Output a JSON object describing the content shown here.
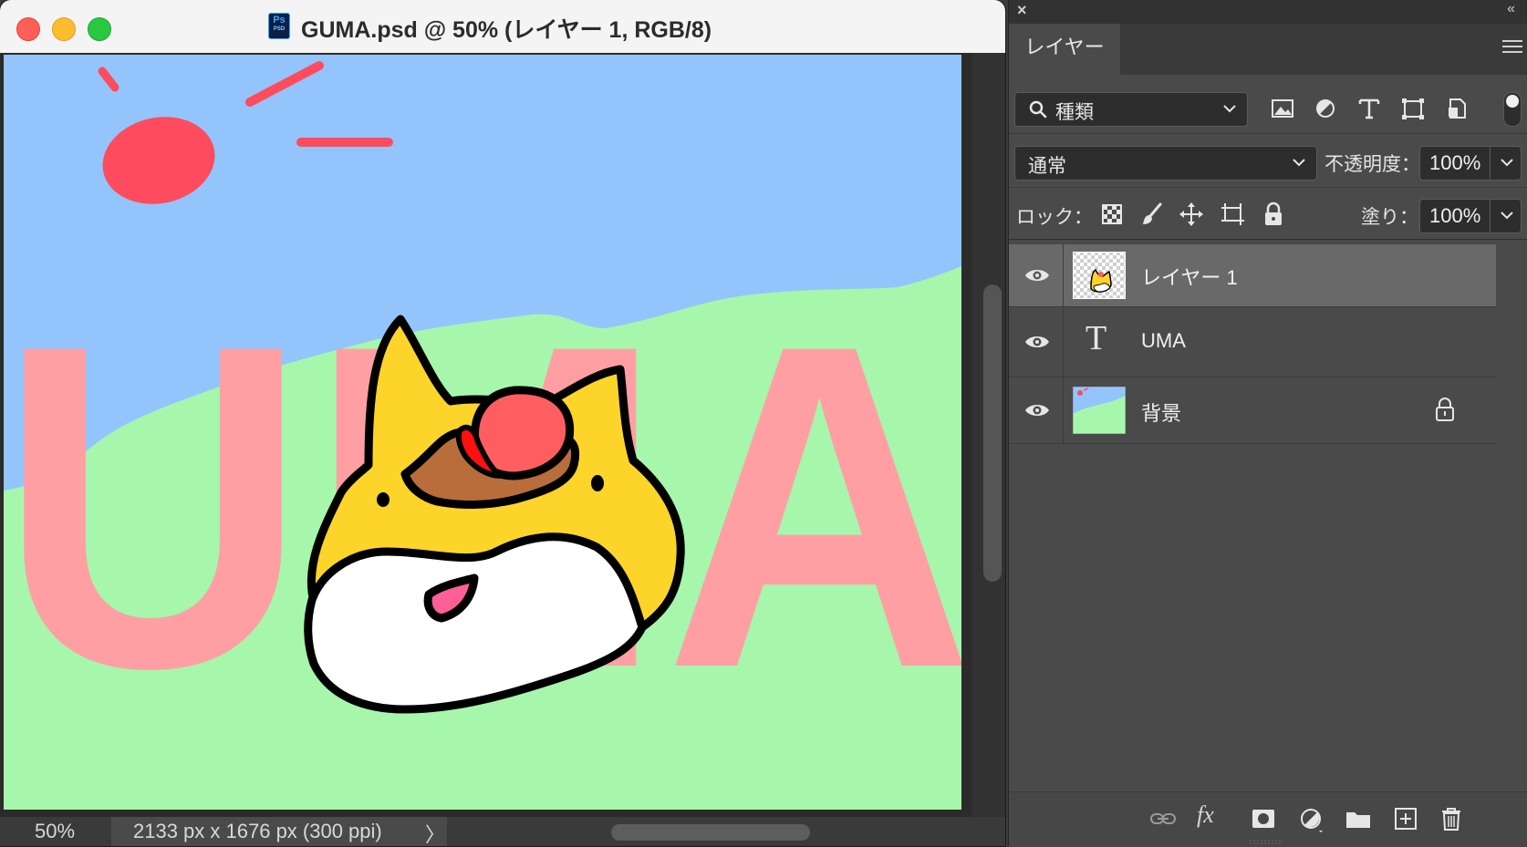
{
  "document": {
    "title": "GUMA.psd @ 50% (レイヤー 1, RGB/8)",
    "file_icon": {
      "label": "Ps",
      "sub": "PSD"
    },
    "zoom": "50%",
    "info": "2133 px x 1676 px (300 ppi)",
    "status_chevron": "〉",
    "canvas_text": "UMA"
  },
  "layers_panel": {
    "tab_label": "レイヤー",
    "filter": {
      "label": "種類",
      "icons": [
        "image-filter-icon",
        "adjustment-filter-icon",
        "type-filter-icon",
        "shape-filter-icon",
        "smart-object-filter-icon"
      ]
    },
    "blend_mode": "通常",
    "opacity_label": "不透明度：",
    "opacity_value": "100%",
    "lock_label": "ロック：",
    "fill_label": "塗り：",
    "fill_value": "100%",
    "layers": [
      {
        "name": "レイヤー 1",
        "selected": true,
        "visible": true,
        "kind": "pixel"
      },
      {
        "name": "UMA",
        "selected": false,
        "visible": true,
        "kind": "type",
        "icon": "T"
      },
      {
        "name": "背景",
        "selected": false,
        "visible": true,
        "kind": "background",
        "locked": true
      }
    ]
  },
  "colors": {
    "sky": "#94c4fc",
    "grass": "#a6f7ab",
    "text_pink": "#ff9fa4",
    "sun_red": "#ff4b5e",
    "corgi_yellow": "#fdd429"
  }
}
